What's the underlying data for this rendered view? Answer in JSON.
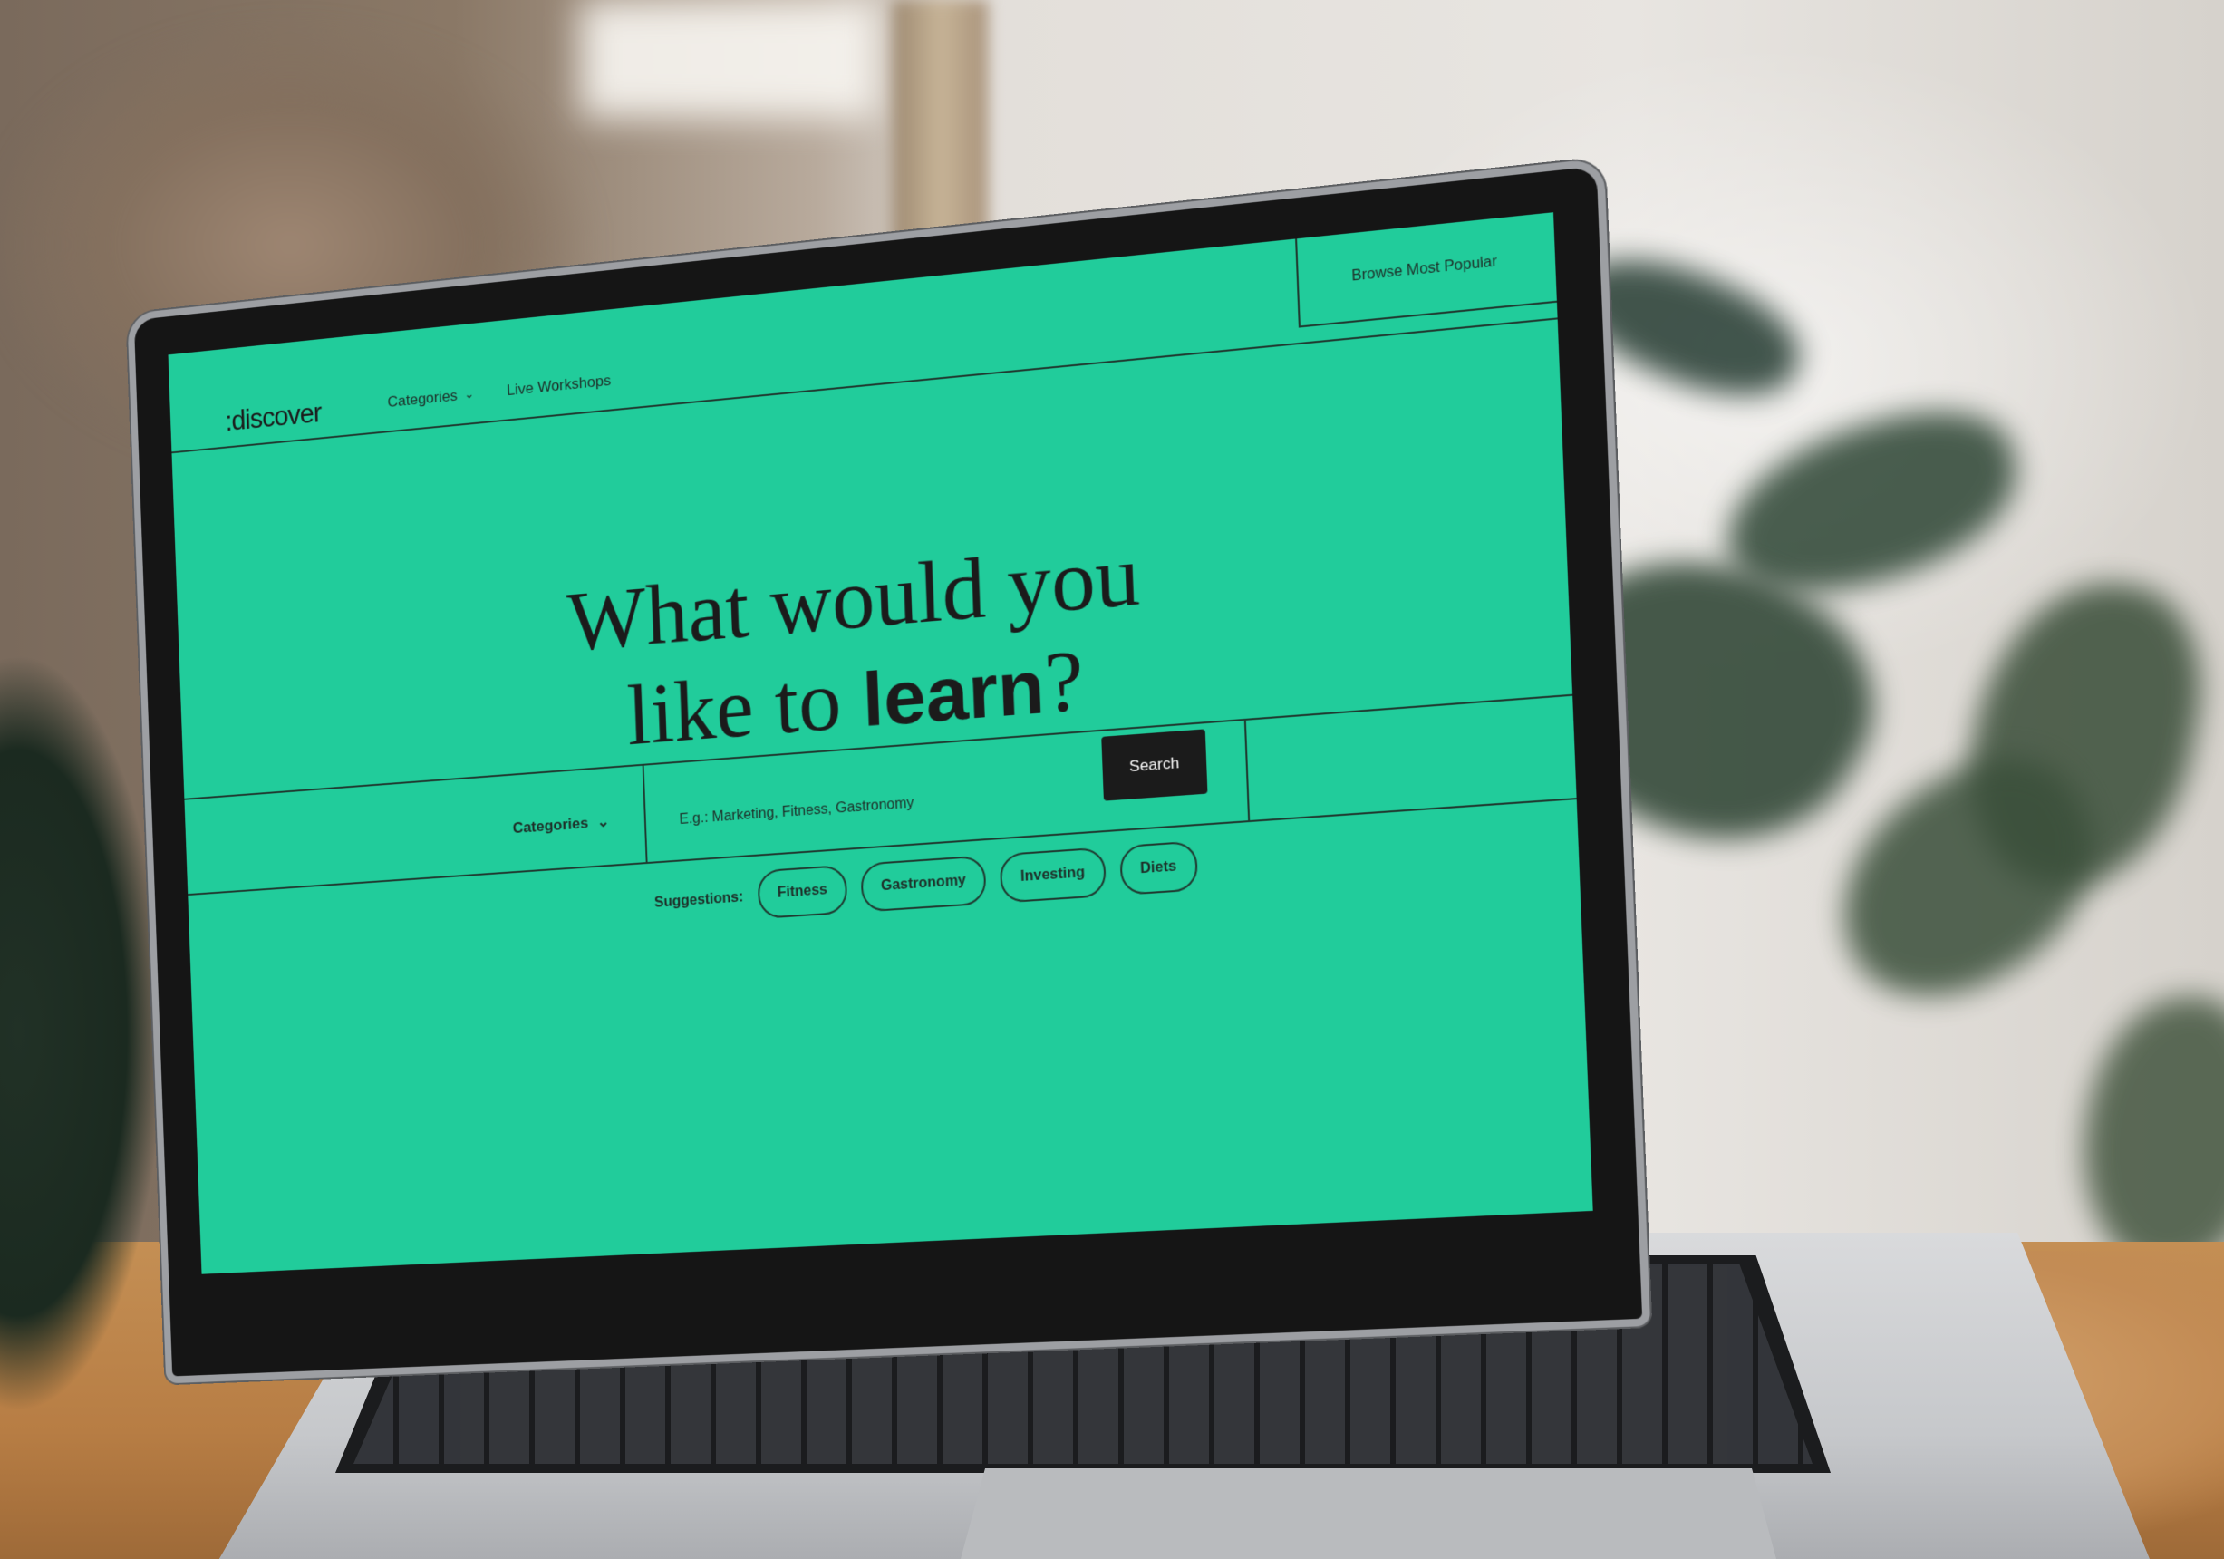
{
  "site": {
    "brand": ":discover",
    "nav": {
      "categories_label": "Categories",
      "workshops_label": "Live Workshops",
      "browse_label": "Browse Most Popular"
    },
    "hero": {
      "line1": "What would you",
      "line2_prefix": "like to ",
      "line2_strong": "learn",
      "line2_suffix": "?"
    },
    "search": {
      "category_label": "Categories",
      "placeholder": "E.g.: Marketing, Fitness, Gastronomy",
      "value": "",
      "button_label": "Search"
    },
    "suggestions": {
      "label": "Suggestions:",
      "items": [
        "Fitness",
        "Gastronomy",
        "Investing",
        "Diets"
      ]
    }
  },
  "colors": {
    "brand_green": "#21cc9b",
    "ink": "#1b1b1b",
    "button_bg": "#1b1b1b",
    "button_text": "#ffffff"
  },
  "icons": {
    "chevron": "chevron-down-icon"
  }
}
